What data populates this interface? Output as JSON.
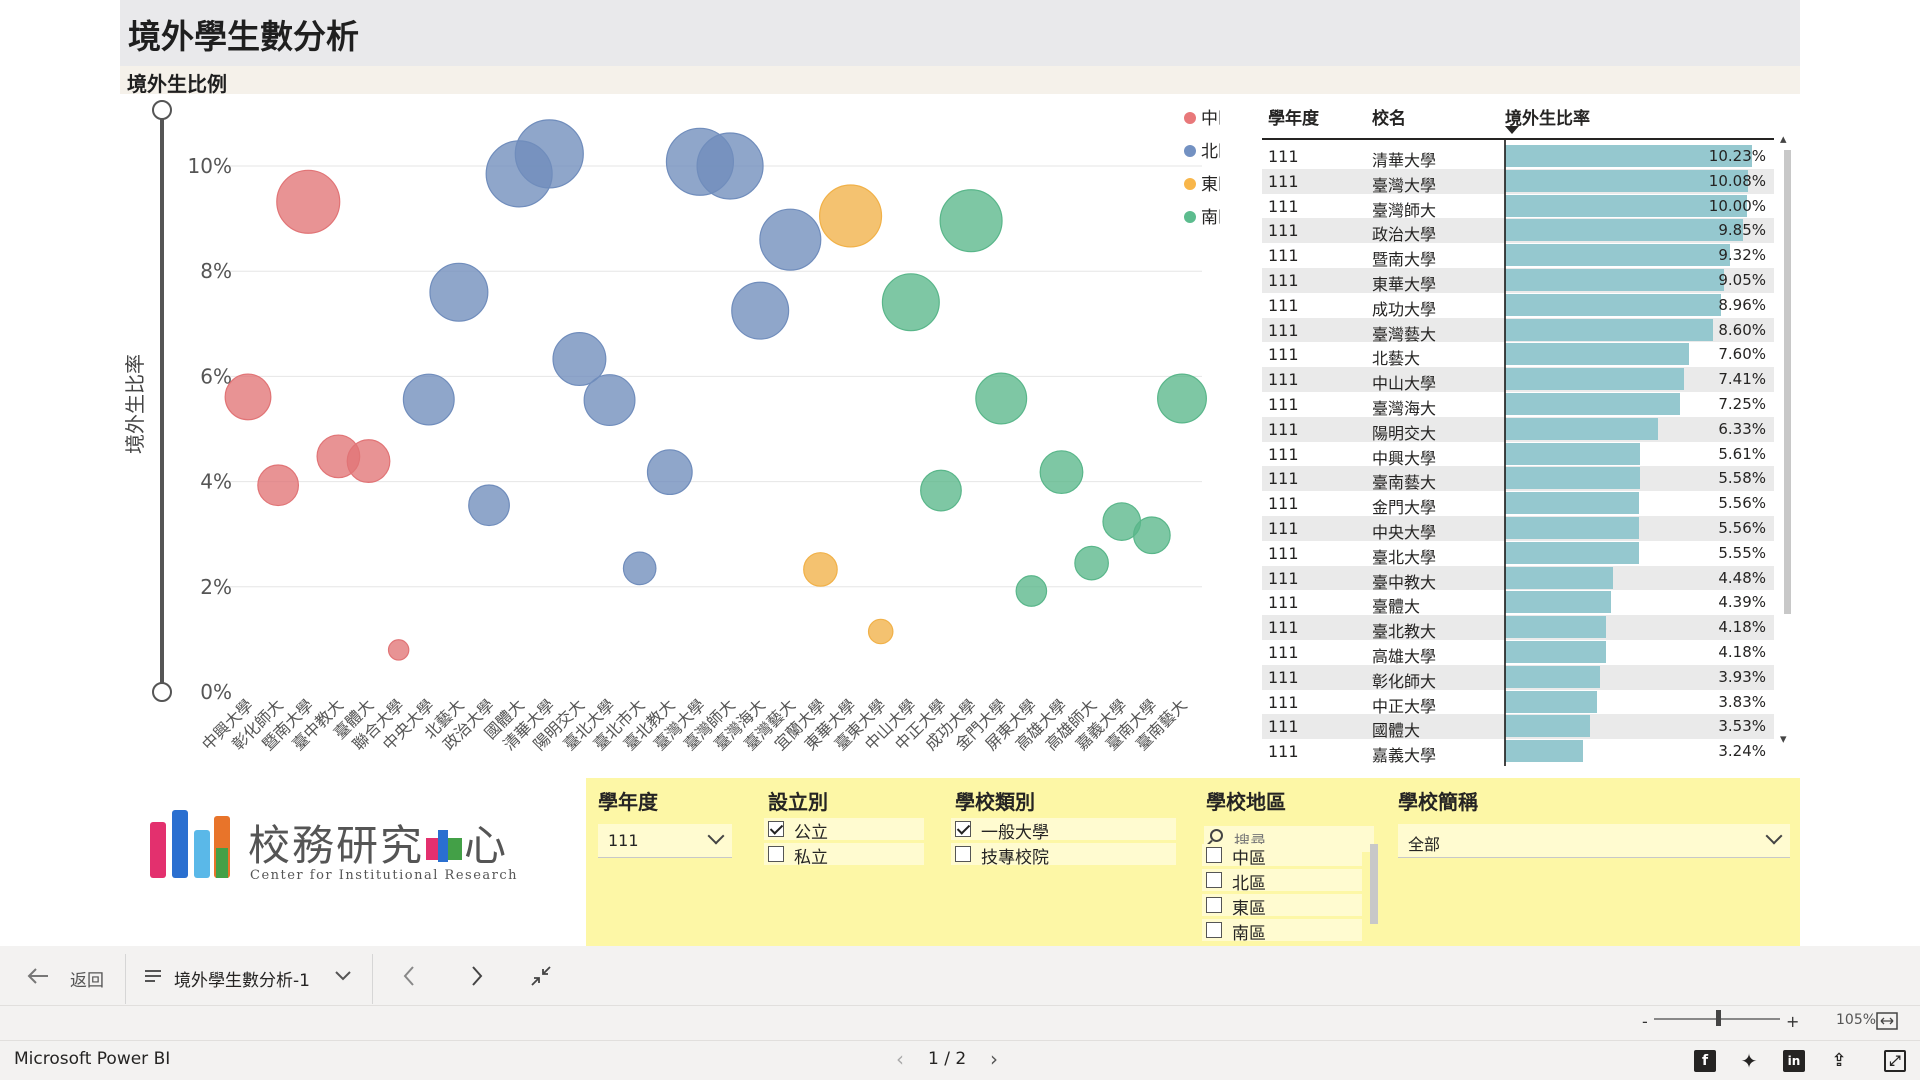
{
  "page": {
    "title": "境外學生數分析",
    "chart_heading": "境外生比例"
  },
  "colors": {
    "中區": "#e8787a",
    "北區": "#7391c2",
    "東區": "#f8b64a",
    "南區": "#5cbc8e",
    "table_bar": "#95c8cf",
    "slicer_bg": "#fdf7a6"
  },
  "chart_data": {
    "type": "scatter",
    "title": "",
    "xlabel": "",
    "ylabel": "境外生比率",
    "ylim": [
      0,
      11
    ],
    "yticks": [
      "0%",
      "2%",
      "4%",
      "6%",
      "8%",
      "10%"
    ],
    "grid": true,
    "legend": [
      "中區",
      "北區",
      "東區",
      "南區"
    ],
    "legend_position": "top-right",
    "categories": [
      "中興大學",
      "彰化師大",
      "暨南大學",
      "臺中教大",
      "臺體大",
      "聯合大學",
      "中央大學",
      "北藝大",
      "政治大學",
      "國體大",
      "清華大學",
      "陽明交大",
      "臺北大學",
      "臺北市大",
      "臺北教大",
      "臺灣大學",
      "臺灣師大",
      "臺灣海大",
      "臺灣藝大",
      "宜蘭大學",
      "東華大學",
      "臺東大學",
      "中山大學",
      "中正大學",
      "成功大學",
      "金門大學",
      "屏東大學",
      "高雄大學",
      "高雄師大",
      "嘉義大學",
      "臺南大學",
      "臺南藝大"
    ],
    "points": [
      {
        "school": "中興大學",
        "region": "中區",
        "y": 5.61,
        "size": 0.45
      },
      {
        "school": "彰化師大",
        "region": "中區",
        "y": 3.93,
        "size": 0.4
      },
      {
        "school": "暨南大學",
        "region": "中區",
        "y": 9.32,
        "size": 0.62
      },
      {
        "school": "臺中教大",
        "region": "中區",
        "y": 4.48,
        "size": 0.42
      },
      {
        "school": "臺體大",
        "region": "中區",
        "y": 4.39,
        "size": 0.42
      },
      {
        "school": "聯合大學",
        "region": "中區",
        "y": 0.8,
        "size": 0.2
      },
      {
        "school": "中央大學",
        "region": "北區",
        "y": 5.56,
        "size": 0.5
      },
      {
        "school": "北藝大",
        "region": "北區",
        "y": 7.6,
        "size": 0.57
      },
      {
        "school": "政治大學",
        "region": "北區",
        "y": 3.55,
        "size": 0.4
      },
      {
        "school": "國體大",
        "region": "北區",
        "y": 9.85,
        "size": 0.65
      },
      {
        "school": "清華大學",
        "region": "北區",
        "y": 10.23,
        "size": 0.67
      },
      {
        "school": "陽明交大",
        "region": "北區",
        "y": 6.33,
        "size": 0.52
      },
      {
        "school": "臺北大學",
        "region": "北區",
        "y": 5.55,
        "size": 0.5
      },
      {
        "school": "臺北市大",
        "region": "北區",
        "y": 2.35,
        "size": 0.32
      },
      {
        "school": "臺北教大",
        "region": "北區",
        "y": 4.18,
        "size": 0.44
      },
      {
        "school": "臺灣大學",
        "region": "北區",
        "y": 10.08,
        "size": 0.66
      },
      {
        "school": "臺灣師大",
        "region": "北區",
        "y": 10.0,
        "size": 0.65
      },
      {
        "school": "臺灣海大",
        "region": "北區",
        "y": 7.25,
        "size": 0.56
      },
      {
        "school": "臺灣藝大",
        "region": "北區",
        "y": 8.6,
        "size": 0.6
      },
      {
        "school": "宜蘭大學",
        "region": "東區",
        "y": 2.33,
        "size": 0.33
      },
      {
        "school": "東華大學",
        "region": "東區",
        "y": 9.05,
        "size": 0.61
      },
      {
        "school": "臺東大學",
        "region": "東區",
        "y": 1.15,
        "size": 0.24
      },
      {
        "school": "中山大學",
        "region": "南區",
        "y": 7.41,
        "size": 0.56
      },
      {
        "school": "中正大學",
        "region": "南區",
        "y": 3.83,
        "size": 0.4
      },
      {
        "school": "成功大學",
        "region": "南區",
        "y": 8.96,
        "size": 0.61
      },
      {
        "school": "金門大學",
        "region": "南區",
        "y": 5.58,
        "size": 0.5
      },
      {
        "school": "屏東大學",
        "region": "南區",
        "y": 1.92,
        "size": 0.3
      },
      {
        "school": "高雄大學",
        "region": "南區",
        "y": 4.18,
        "size": 0.42
      },
      {
        "school": "高雄師大",
        "region": "南區",
        "y": 2.45,
        "size": 0.33
      },
      {
        "school": "嘉義大學",
        "region": "南區",
        "y": 3.24,
        "size": 0.37
      },
      {
        "school": "臺南大學",
        "region": "南區",
        "y": 2.98,
        "size": 0.36
      },
      {
        "school": "臺南藝大",
        "region": "南區",
        "y": 5.58,
        "size": 0.48
      }
    ]
  },
  "table": {
    "headers": [
      "學年度",
      "校名",
      "境外生比率"
    ],
    "rows": [
      {
        "year": "111",
        "school": "清華大學",
        "rate": 10.23,
        "label": "10.23%"
      },
      {
        "year": "111",
        "school": "臺灣大學",
        "rate": 10.08,
        "label": "10.08%"
      },
      {
        "year": "111",
        "school": "臺灣師大",
        "rate": 10.0,
        "label": "10.00%"
      },
      {
        "year": "111",
        "school": "政治大學",
        "rate": 9.85,
        "label": "9.85%"
      },
      {
        "year": "111",
        "school": "暨南大學",
        "rate": 9.32,
        "label": "9.32%"
      },
      {
        "year": "111",
        "school": "東華大學",
        "rate": 9.05,
        "label": "9.05%"
      },
      {
        "year": "111",
        "school": "成功大學",
        "rate": 8.96,
        "label": "8.96%"
      },
      {
        "year": "111",
        "school": "臺灣藝大",
        "rate": 8.6,
        "label": "8.60%"
      },
      {
        "year": "111",
        "school": "北藝大",
        "rate": 7.6,
        "label": "7.60%"
      },
      {
        "year": "111",
        "school": "中山大學",
        "rate": 7.41,
        "label": "7.41%"
      },
      {
        "year": "111",
        "school": "臺灣海大",
        "rate": 7.25,
        "label": "7.25%"
      },
      {
        "year": "111",
        "school": "陽明交大",
        "rate": 6.33,
        "label": "6.33%"
      },
      {
        "year": "111",
        "school": "中興大學",
        "rate": 5.61,
        "label": "5.61%"
      },
      {
        "year": "111",
        "school": "臺南藝大",
        "rate": 5.58,
        "label": "5.58%"
      },
      {
        "year": "111",
        "school": "金門大學",
        "rate": 5.56,
        "label": "5.56%"
      },
      {
        "year": "111",
        "school": "中央大學",
        "rate": 5.56,
        "label": "5.56%"
      },
      {
        "year": "111",
        "school": "臺北大學",
        "rate": 5.55,
        "label": "5.55%"
      },
      {
        "year": "111",
        "school": "臺中教大",
        "rate": 4.48,
        "label": "4.48%"
      },
      {
        "year": "111",
        "school": "臺體大",
        "rate": 4.39,
        "label": "4.39%"
      },
      {
        "year": "111",
        "school": "臺北教大",
        "rate": 4.18,
        "label": "4.18%"
      },
      {
        "year": "111",
        "school": "高雄大學",
        "rate": 4.18,
        "label": "4.18%"
      },
      {
        "year": "111",
        "school": "彰化師大",
        "rate": 3.93,
        "label": "3.93%"
      },
      {
        "year": "111",
        "school": "中正大學",
        "rate": 3.83,
        "label": "3.83%"
      },
      {
        "year": "111",
        "school": "國體大",
        "rate": 3.53,
        "label": "3.53%"
      },
      {
        "year": "111",
        "school": "嘉義大學",
        "rate": 3.24,
        "label": "3.24%"
      }
    ]
  },
  "slicers": {
    "year": {
      "label": "學年度",
      "value": "111"
    },
    "type": {
      "label": "設立別",
      "options": [
        {
          "label": "公立",
          "checked": true
        },
        {
          "label": "私立",
          "checked": false
        }
      ]
    },
    "category": {
      "label": "學校類別",
      "options": [
        {
          "label": "一般大學",
          "checked": true
        },
        {
          "label": "技專校院",
          "checked": false
        }
      ]
    },
    "region": {
      "label": "學校地區",
      "search_placeholder": "搜尋",
      "options": [
        {
          "label": "中區",
          "checked": false
        },
        {
          "label": "北區",
          "checked": false
        },
        {
          "label": "東區",
          "checked": false
        },
        {
          "label": "南區",
          "checked": false
        }
      ]
    },
    "short_name": {
      "label": "學校簡稱",
      "value": "全部"
    }
  },
  "logo": {
    "name_part1": "校務研究",
    "name_part2": "心",
    "english": "Center for Institutional Research"
  },
  "nav": {
    "back": "返回",
    "page_name": "境外學生數分析-1"
  },
  "zoom": {
    "minus": "-",
    "plus": "+",
    "level": "105%"
  },
  "status": {
    "brand": "Microsoft Power BI",
    "pager": "1 / 2"
  }
}
